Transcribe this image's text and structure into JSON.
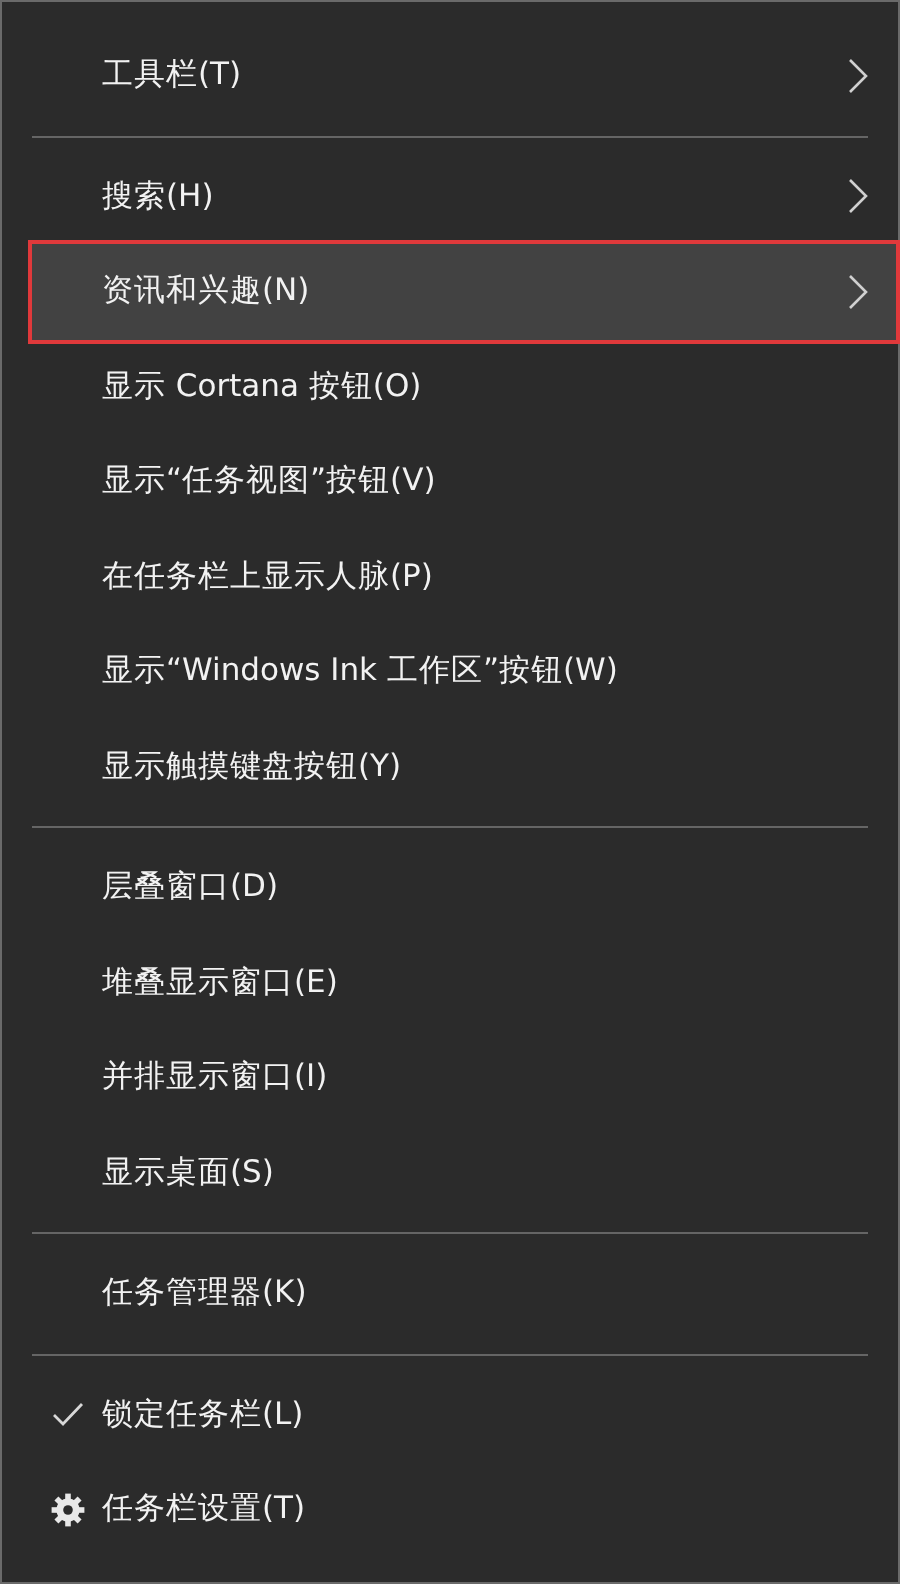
{
  "menu": {
    "sections": [
      {
        "items": [
          {
            "kind": "submenu",
            "label": "工具栏(T)",
            "highlighted": false,
            "outlined": false
          }
        ]
      },
      {
        "items": [
          {
            "kind": "submenu",
            "label": "搜索(H)",
            "highlighted": false,
            "outlined": false
          },
          {
            "kind": "submenu",
            "label": "资讯和兴趣(N)",
            "highlighted": true,
            "outlined": true
          },
          {
            "kind": "command",
            "label": "显示 Cortana 按钮(O)",
            "highlighted": false,
            "outlined": false
          },
          {
            "kind": "command",
            "label": "显示“任务视图”按钮(V)",
            "highlighted": false,
            "outlined": false
          },
          {
            "kind": "command",
            "label": "在任务栏上显示人脉(P)",
            "highlighted": false,
            "outlined": false
          },
          {
            "kind": "command",
            "label": "显示“Windows Ink 工作区”按钮(W)",
            "highlighted": false,
            "outlined": false
          },
          {
            "kind": "command",
            "label": "显示触摸键盘按钮(Y)",
            "highlighted": false,
            "outlined": false
          }
        ]
      },
      {
        "items": [
          {
            "kind": "command",
            "label": "层叠窗口(D)",
            "highlighted": false,
            "outlined": false
          },
          {
            "kind": "command",
            "label": "堆叠显示窗口(E)",
            "highlighted": false,
            "outlined": false
          },
          {
            "kind": "command",
            "label": "并排显示窗口(I)",
            "highlighted": false,
            "outlined": false
          },
          {
            "kind": "command",
            "label": "显示桌面(S)",
            "highlighted": false,
            "outlined": false
          }
        ]
      },
      {
        "items": [
          {
            "kind": "command",
            "label": "任务管理器(K)",
            "highlighted": false,
            "outlined": false
          }
        ]
      },
      {
        "items": [
          {
            "kind": "check",
            "label": "锁定任务栏(L)",
            "checked": true,
            "highlighted": false,
            "outlined": false
          },
          {
            "kind": "settings",
            "label": "任务栏设置(T)",
            "highlighted": false,
            "outlined": false
          }
        ]
      }
    ]
  }
}
